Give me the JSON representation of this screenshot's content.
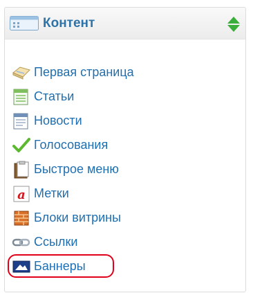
{
  "panel": {
    "title": "Контент",
    "header_icon": "window-icon",
    "toggle_icon": "sort-arrows-icon"
  },
  "menu": {
    "items": [
      {
        "label": "Первая страница",
        "icon": "home-page-icon"
      },
      {
        "label": "Статьи",
        "icon": "articles-icon"
      },
      {
        "label": "Новости",
        "icon": "news-icon"
      },
      {
        "label": "Голосования",
        "icon": "checkmark-icon"
      },
      {
        "label": "Быстрое меню",
        "icon": "quick-menu-icon"
      },
      {
        "label": "Метки",
        "icon": "tags-icon"
      },
      {
        "label": "Блоки витрины",
        "icon": "showcase-blocks-icon"
      },
      {
        "label": "Ссылки",
        "icon": "links-icon"
      },
      {
        "label": "Баннеры",
        "icon": "banners-icon",
        "highlighted": true
      }
    ]
  },
  "colors": {
    "link": "#1f6fb0",
    "title": "#2e73a8",
    "highlight": "#e1001a",
    "toggle": "#3aae3a"
  }
}
